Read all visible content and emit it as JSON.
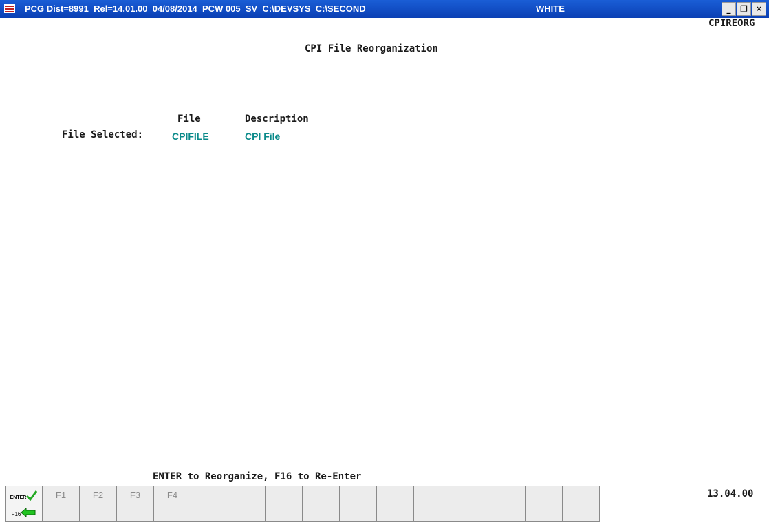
{
  "window": {
    "title_main": "PCG Dist=8991  Rel=14.01.00  04/08/2014  PCW 005  SV  C:\\DEVSYS  C:\\SECOND",
    "title_right": "WHITE",
    "minimize": "_",
    "maximize": "❐",
    "close": "✕"
  },
  "header": {
    "program_id": "CPIREORG",
    "title": "CPI File Reorganization"
  },
  "selection": {
    "col_file": "File",
    "col_description": "Description",
    "label": "File Selected:",
    "file_value": "CPIFILE",
    "description_value": "CPI File"
  },
  "footer": {
    "prompt": "ENTER to Reorganize, F16 to Re-Enter",
    "time": "13.04.00"
  },
  "fkeys": {
    "enter_label": "ENTER",
    "f16_label": "F16",
    "row1": [
      "F1",
      "F2",
      "F3",
      "F4",
      "",
      "",
      "",
      "",
      "",
      "",
      "",
      "",
      "",
      "",
      ""
    ],
    "row2": [
      "",
      "",
      "",
      "",
      "",
      "",
      "",
      "",
      "",
      "",
      "",
      "",
      "",
      "",
      ""
    ]
  },
  "colors": {
    "titlebar": "#0a3fb4",
    "field_value": "#0a8a8a",
    "enter_check": "#22a822",
    "f16_arrow": "#22c422"
  }
}
